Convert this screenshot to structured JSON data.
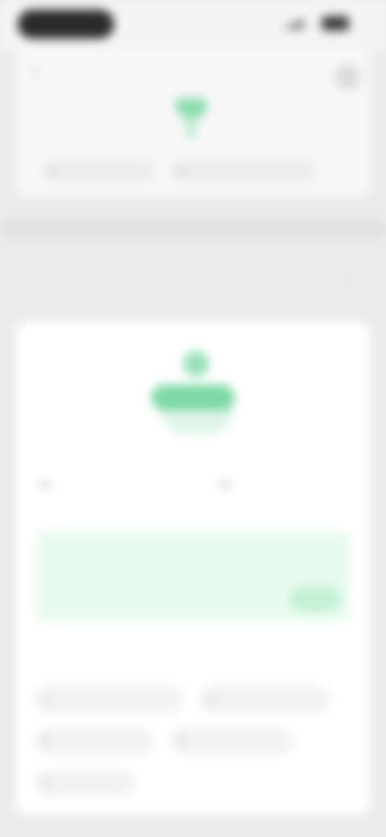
{
  "status": {
    "time": ""
  },
  "header": {
    "left_meta": "",
    "right_meta": "",
    "chips": [
      "",
      ""
    ]
  },
  "section": {
    "title": ""
  },
  "card": {
    "badge": "",
    "stats": [
      {
        "value": "",
        "label": ""
      },
      {
        "value": "",
        "label": ""
      }
    ],
    "notice": {
      "text": "",
      "link": "",
      "button": ""
    },
    "tags_title": "",
    "tags": [
      "",
      "",
      "",
      "",
      ""
    ]
  },
  "colors": {
    "accent": "#7ed9a5",
    "accent_light": "#e8fbee",
    "background": "#ececec",
    "card": "#ffffff"
  },
  "icons": [
    "back-icon",
    "more-icon",
    "plant-icon",
    "signal-icon",
    "battery-icon"
  ]
}
